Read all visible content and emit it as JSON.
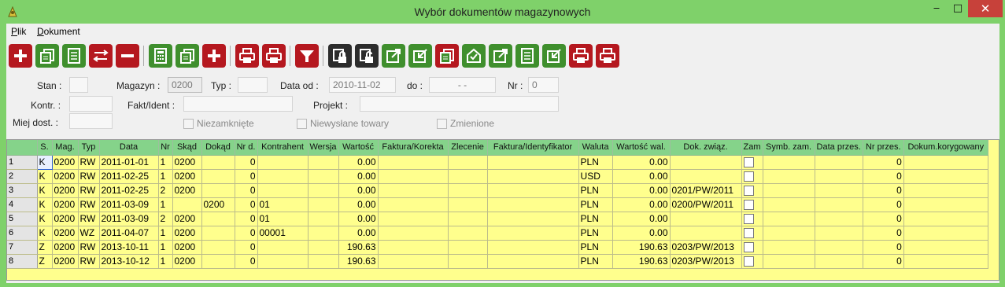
{
  "window": {
    "title": "Wybór dokumentów magazynowych",
    "min": "‒",
    "max": "□",
    "close": "✕"
  },
  "menu": {
    "file": "Plik",
    "document": "Dokument"
  },
  "toolbar": [
    {
      "name": "add-button",
      "color": "#b5181f",
      "icon": "plus-icon"
    },
    {
      "name": "copy-button",
      "color": "#3f8f2d",
      "icon": "copy-icon"
    },
    {
      "name": "edit-button",
      "color": "#3f8f2d",
      "icon": "document-icon"
    },
    {
      "name": "swap-button",
      "color": "#b5181f",
      "icon": "swap-icon"
    },
    {
      "name": "delete-button",
      "color": "#b5181f",
      "icon": "minus-icon"
    },
    {
      "name": "calculator-button",
      "color": "#3f8f2d",
      "icon": "calculator-icon"
    },
    {
      "name": "copy2-button",
      "color": "#3f8f2d",
      "icon": "copy-icon"
    },
    {
      "name": "add2-button",
      "color": "#b5181f",
      "icon": "plus-icon"
    },
    {
      "name": "print-l-button",
      "color": "#b5181f",
      "icon": "printer-icon"
    },
    {
      "name": "print-d-button",
      "color": "#b5181f",
      "icon": "printer-icon"
    },
    {
      "name": "filter-button",
      "color": "#b5181f",
      "icon": "filter-icon"
    },
    {
      "name": "lock-button",
      "color": "#2c2c2c",
      "icon": "lock-icon"
    },
    {
      "name": "unlock-button",
      "color": "#2c2c2c",
      "icon": "unlock-icon"
    },
    {
      "name": "export-button",
      "color": "#3f8f2d",
      "icon": "export-icon"
    },
    {
      "name": "import-button",
      "color": "#3f8f2d",
      "icon": "import-icon"
    },
    {
      "name": "copy-d-button",
      "color": "#b5181f",
      "icon": "copy-icon"
    },
    {
      "name": "approve-button",
      "color": "#3f8f2d",
      "icon": "approve-icon"
    },
    {
      "name": "export2-button",
      "color": "#3f8f2d",
      "icon": "export-icon"
    },
    {
      "name": "list-button",
      "color": "#3f8f2d",
      "icon": "document-icon"
    },
    {
      "name": "import2-button",
      "color": "#3f8f2d",
      "icon": "import-icon"
    },
    {
      "name": "print-l2-button",
      "color": "#b5181f",
      "icon": "printer-icon"
    },
    {
      "name": "print-d2-button",
      "color": "#b5181f",
      "icon": "printer-icon"
    }
  ],
  "filters": {
    "stan_label": "Stan :",
    "stan_value": "",
    "magazyn_label": "Magazyn :",
    "magazyn_value": "0200",
    "typ_label": "Typ :",
    "typ_value": "",
    "data_od_label": "Data od :",
    "data_od_value": "2010-11-02",
    "do_label": "do :",
    "do_value": "  -  -  ",
    "nr_label": "Nr :",
    "nr_value": "0",
    "kontr_label": "Kontr. :",
    "kontr_value": "",
    "fakt_label": "Fakt/Ident :",
    "fakt_value": "",
    "projekt_label": "Projekt :",
    "projekt_value": "",
    "miej_label": "Miej dost. :",
    "miej_value": "",
    "niezamkniete": "Niezamknięte",
    "niewyslane": "Niewysłane towary",
    "zmienione": "Zmienione"
  },
  "table": {
    "columns": [
      "",
      "S.",
      "Mag.",
      "Typ",
      "Data",
      "Nr",
      "Skąd",
      "Dokąd",
      "Nr d.",
      "Kontrahent",
      "Wersja",
      "Wartość",
      "Faktura/Korekta",
      "Zlecenie",
      "Faktura/Identyfikator",
      "Waluta",
      "Wartość wal.",
      "Dok. związ.",
      "Zam",
      "Symb. zam.",
      "Data przes.",
      "Nr przes.",
      "Dokum.korygowany"
    ],
    "rows": [
      [
        "1",
        "K",
        "0200",
        "RW",
        "2011-01-01",
        "1",
        "0200",
        "",
        "0",
        "",
        "",
        "0.00",
        "",
        "",
        "",
        "PLN",
        "0.00",
        "",
        "",
        "",
        "",
        "0",
        ""
      ],
      [
        "2",
        "K",
        "0200",
        "RW",
        "2011-02-25",
        "1",
        "0200",
        "",
        "0",
        "",
        "",
        "0.00",
        "",
        "",
        "",
        "USD",
        "0.00",
        "",
        "",
        "",
        "",
        "0",
        ""
      ],
      [
        "3",
        "K",
        "0200",
        "RW",
        "2011-02-25",
        "2",
        "0200",
        "",
        "0",
        "",
        "",
        "0.00",
        "",
        "",
        "",
        "PLN",
        "0.00",
        "0201/PW/2011",
        "",
        "",
        "",
        "0",
        ""
      ],
      [
        "4",
        "K",
        "0200",
        "RW",
        "2011-03-09",
        "1",
        "",
        "0200",
        "0",
        "01",
        "",
        "0.00",
        "",
        "",
        "",
        "PLN",
        "0.00",
        "0200/PW/2011",
        "",
        "",
        "",
        "0",
        ""
      ],
      [
        "5",
        "K",
        "0200",
        "RW",
        "2011-03-09",
        "2",
        "0200",
        "",
        "0",
        "01",
        "",
        "0.00",
        "",
        "",
        "",
        "PLN",
        "0.00",
        "",
        "",
        "",
        "",
        "0",
        ""
      ],
      [
        "6",
        "K",
        "0200",
        "WZ",
        "2011-04-07",
        "1",
        "0200",
        "",
        "0",
        "00001",
        "",
        "0.00",
        "",
        "",
        "",
        "PLN",
        "0.00",
        "",
        "",
        "",
        "",
        "0",
        ""
      ],
      [
        "7",
        "Z",
        "0200",
        "RW",
        "2013-10-11",
        "1",
        "0200",
        "",
        "0",
        "",
        "",
        "190.63",
        "",
        "",
        "",
        "PLN",
        "190.63",
        "0203/PW/2013",
        "",
        "",
        "",
        "0",
        ""
      ],
      [
        "8",
        "Z",
        "0200",
        "RW",
        "2013-10-12",
        "1",
        "0200",
        "",
        "0",
        "",
        "",
        "190.63",
        "",
        "",
        "",
        "PLN",
        "190.63",
        "0203/PW/2013",
        "",
        "",
        "",
        "0",
        ""
      ]
    ]
  }
}
